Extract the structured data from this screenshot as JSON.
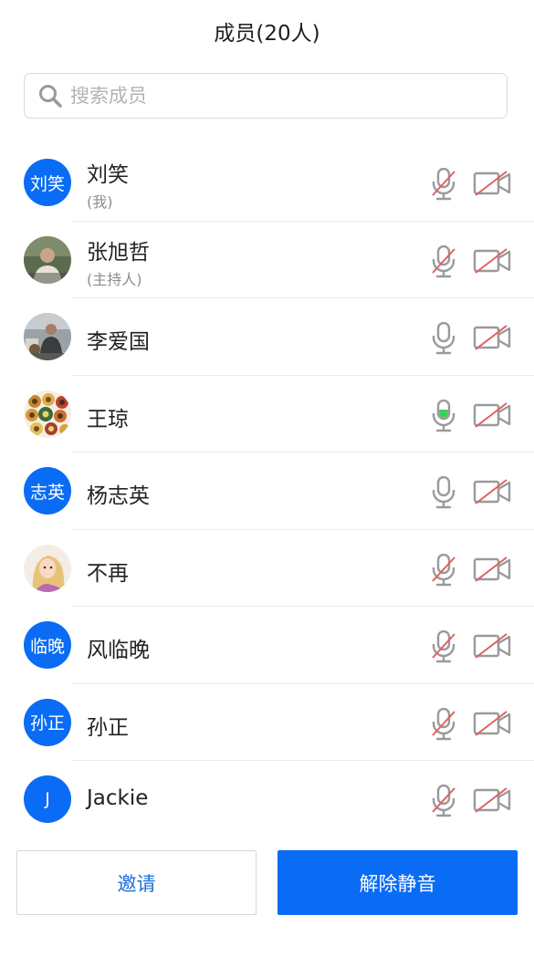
{
  "header": {
    "title": "成员(20人)"
  },
  "search": {
    "placeholder": "搜索成员",
    "value": ""
  },
  "members": [
    {
      "name": "刘笑",
      "sub": "(我)",
      "avatar_type": "text",
      "avatar_text": "刘笑",
      "mic": "muted",
      "camera": "off"
    },
    {
      "name": "张旭哲",
      "sub": "(主持人)",
      "avatar_type": "photo",
      "avatar_text": "",
      "mic": "muted",
      "camera": "off"
    },
    {
      "name": "李爱国",
      "sub": "",
      "avatar_type": "photo",
      "avatar_text": "",
      "mic": "on",
      "camera": "off"
    },
    {
      "name": "王琼",
      "sub": "",
      "avatar_type": "photo",
      "avatar_text": "",
      "mic": "speaking",
      "camera": "off"
    },
    {
      "name": "杨志英",
      "sub": "",
      "avatar_type": "text",
      "avatar_text": "志英",
      "mic": "on",
      "camera": "off"
    },
    {
      "name": "不再",
      "sub": "",
      "avatar_type": "photo",
      "avatar_text": "",
      "mic": "muted",
      "camera": "off"
    },
    {
      "name": "风临晚",
      "sub": "",
      "avatar_type": "text",
      "avatar_text": "临晚",
      "mic": "muted",
      "camera": "off"
    },
    {
      "name": "孙正",
      "sub": "",
      "avatar_type": "text",
      "avatar_text": "孙正",
      "mic": "muted",
      "camera": "off"
    },
    {
      "name": "Jackie",
      "sub": "",
      "avatar_type": "text",
      "avatar_text": "J",
      "mic": "muted",
      "camera": "off"
    }
  ],
  "footer": {
    "invite_label": "邀请",
    "unmute_label": "解除静音"
  },
  "colors": {
    "accent": "#0a6cf5",
    "speaking": "#3bd05a",
    "muted_slash": "#e06060",
    "icon_gray": "#9a9a9a"
  }
}
